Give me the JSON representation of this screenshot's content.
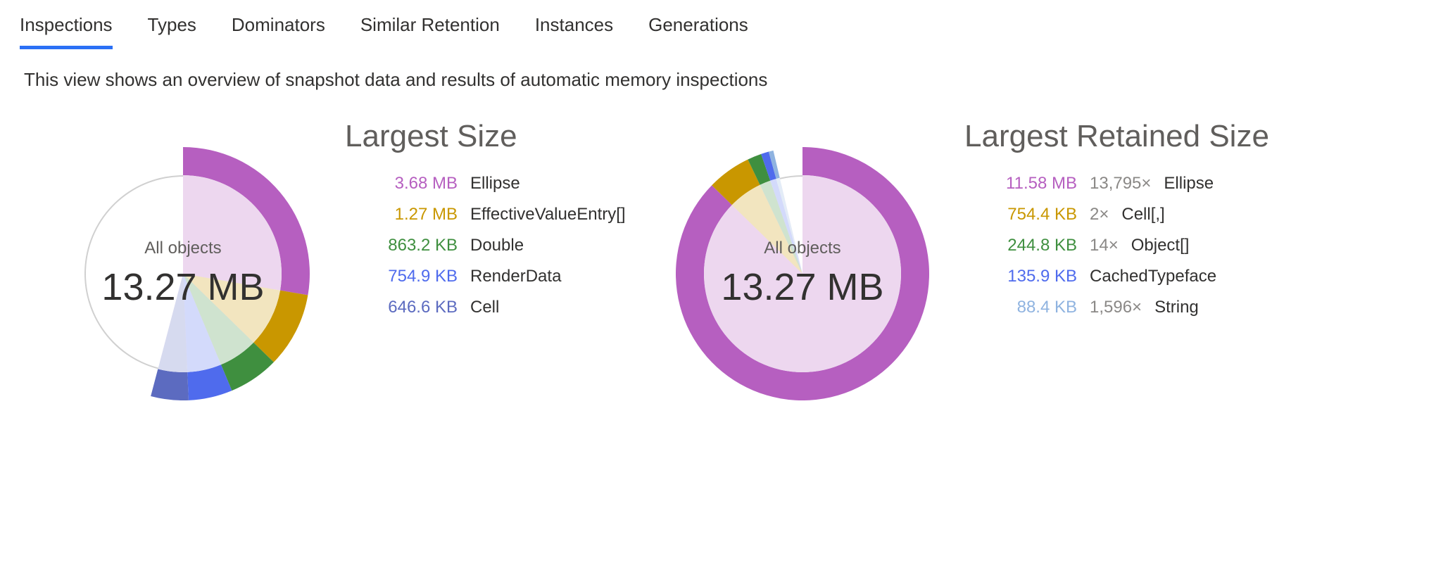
{
  "tabs": [
    {
      "label": "Inspections",
      "active": true
    },
    {
      "label": "Types",
      "active": false
    },
    {
      "label": "Dominators",
      "active": false
    },
    {
      "label": "Similar Retention",
      "active": false
    },
    {
      "label": "Instances",
      "active": false
    },
    {
      "label": "Generations",
      "active": false
    }
  ],
  "description": "This view shows an overview of snapshot data and results of automatic memory inspections",
  "colors": {
    "purple": "#b65fc0",
    "gold": "#c99700",
    "green": "#3f8f3f",
    "blue": "#4f6bed",
    "indigo": "#5c6bc0",
    "softblue": "#8fb3e0",
    "grey": "#d0d0d0",
    "lightpurple": "#f2d9f5"
  },
  "chart_data": [
    {
      "type": "pie",
      "title": "Largest Size",
      "center_label": "All objects",
      "total": "13.27 MB",
      "series": [
        {
          "name": "Ellipse",
          "size_text": "3.68 MB",
          "color_key": "purple",
          "fraction": 0.277
        },
        {
          "name": "EffectiveValueEntry[]",
          "size_text": "1.27 MB",
          "color_key": "gold",
          "fraction": 0.096
        },
        {
          "name": "Double",
          "size_text": "863.2 KB",
          "color_key": "green",
          "fraction": 0.064
        },
        {
          "name": "RenderData",
          "size_text": "754.9 KB",
          "color_key": "blue",
          "fraction": 0.056
        },
        {
          "name": "Cell",
          "size_text": "646.6 KB",
          "color_key": "indigo",
          "fraction": 0.048
        }
      ],
      "other_fraction": 0.459
    },
    {
      "type": "pie",
      "title": "Largest Retained Size",
      "center_label": "All objects",
      "total": "13.27 MB",
      "series": [
        {
          "name": "Ellipse",
          "count_text": "13,795×",
          "size_text": "11.58 MB",
          "color_key": "purple",
          "fraction": 0.873
        },
        {
          "name": "Cell[,]",
          "count_text": "2×",
          "size_text": "754.4 KB",
          "color_key": "gold",
          "fraction": 0.056
        },
        {
          "name": "Object[]",
          "count_text": "14×",
          "size_text": "244.8 KB",
          "color_key": "green",
          "fraction": 0.018
        },
        {
          "name": "CachedTypeface",
          "count_text": "",
          "size_text": "135.9 KB",
          "color_key": "blue",
          "fraction": 0.01
        },
        {
          "name": "String",
          "count_text": "1,596×",
          "size_text": "88.4 KB",
          "color_key": "softblue",
          "fraction": 0.006
        }
      ],
      "other_fraction": 0.037
    }
  ]
}
